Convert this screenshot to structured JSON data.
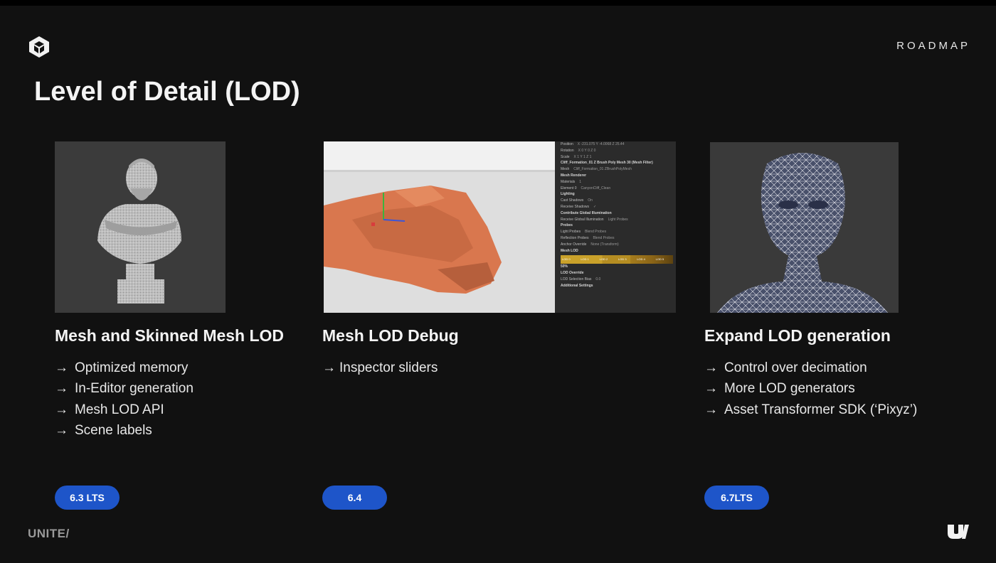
{
  "header": {
    "logo_icon": "unity-cube-icon",
    "section_label": "ROADMAP",
    "title": "Level of Detail (LOD)"
  },
  "columns": [
    {
      "title": "Mesh and Skinned Mesh LOD",
      "image": "marble-bust-mesh",
      "bullets": [
        "Optimized memory",
        "In-Editor generation",
        "Mesh LOD API",
        "Scene labels"
      ],
      "badge": "6.3 LTS"
    },
    {
      "title": "Mesh LOD Debug",
      "image": "cliff-mesh-inspector",
      "bullets": [
        "Inspector sliders"
      ],
      "badge": "6.4"
    },
    {
      "title": "Expand LOD generation",
      "image": "wireframe-head",
      "bullets": [
        "Control over decimation",
        "More LOD generators",
        "Asset Transformer SDK (‘Pixyz’)"
      ],
      "badge": "6.7LTS"
    }
  ],
  "arrow_glyph": "→",
  "inspector": {
    "rows": [
      {
        "label": "Position",
        "value": "X -231.075  Y -4.0068  Z 25.44"
      },
      {
        "label": "Rotation",
        "value": "X 0  Y 0  Z 0"
      },
      {
        "label": "Scale",
        "value": "X 1  Y 1  Z 1"
      },
      {
        "label": "Cliff_Formation_01 Z Brush Poly Mesh 30 (Mesh Filter)",
        "value": ""
      },
      {
        "label": "Mesh",
        "value": "Cliff_Formation_01 ZBrushPolyMesh"
      },
      {
        "label": "Mesh Renderer",
        "value": ""
      },
      {
        "label": "Materials",
        "value": "1"
      },
      {
        "label": "Element 0",
        "value": "CanyonCliff_Clean"
      },
      {
        "label": "Lighting",
        "value": ""
      },
      {
        "label": "Cast Shadows",
        "value": "On"
      },
      {
        "label": "Receive Shadows",
        "value": "✓"
      },
      {
        "label": "Contribute Global Illumination",
        "value": ""
      },
      {
        "label": "Receive Global Illumination",
        "value": "Light Probes"
      },
      {
        "label": "Probes",
        "value": ""
      },
      {
        "label": "Light Probes",
        "value": "Blend Probes"
      },
      {
        "label": "Reflection Probes",
        "value": "Blend Probes"
      },
      {
        "label": "Anchor Override",
        "value": "None (Transform)"
      },
      {
        "label": "Mesh LOD",
        "value": ""
      }
    ],
    "lod_bar_labels": [
      "LOD 0",
      "LOD 1",
      "LOD 2",
      "LOD 3",
      "LOD 4",
      "LOD 5"
    ],
    "after_rows": [
      {
        "label": "50%",
        "value": ""
      },
      {
        "label": "LOD Override",
        "value": ""
      },
      {
        "label": "LOD Selection Bias",
        "value": "0.0"
      },
      {
        "label": "Additional Settings",
        "value": ""
      }
    ]
  },
  "footer": {
    "left_logo_text": "UNITE/",
    "right_logo_icon": "unity-u-logo-icon"
  },
  "colors": {
    "background": "#111111",
    "badge": "#1e55c9",
    "cliff": "#d9774e"
  }
}
